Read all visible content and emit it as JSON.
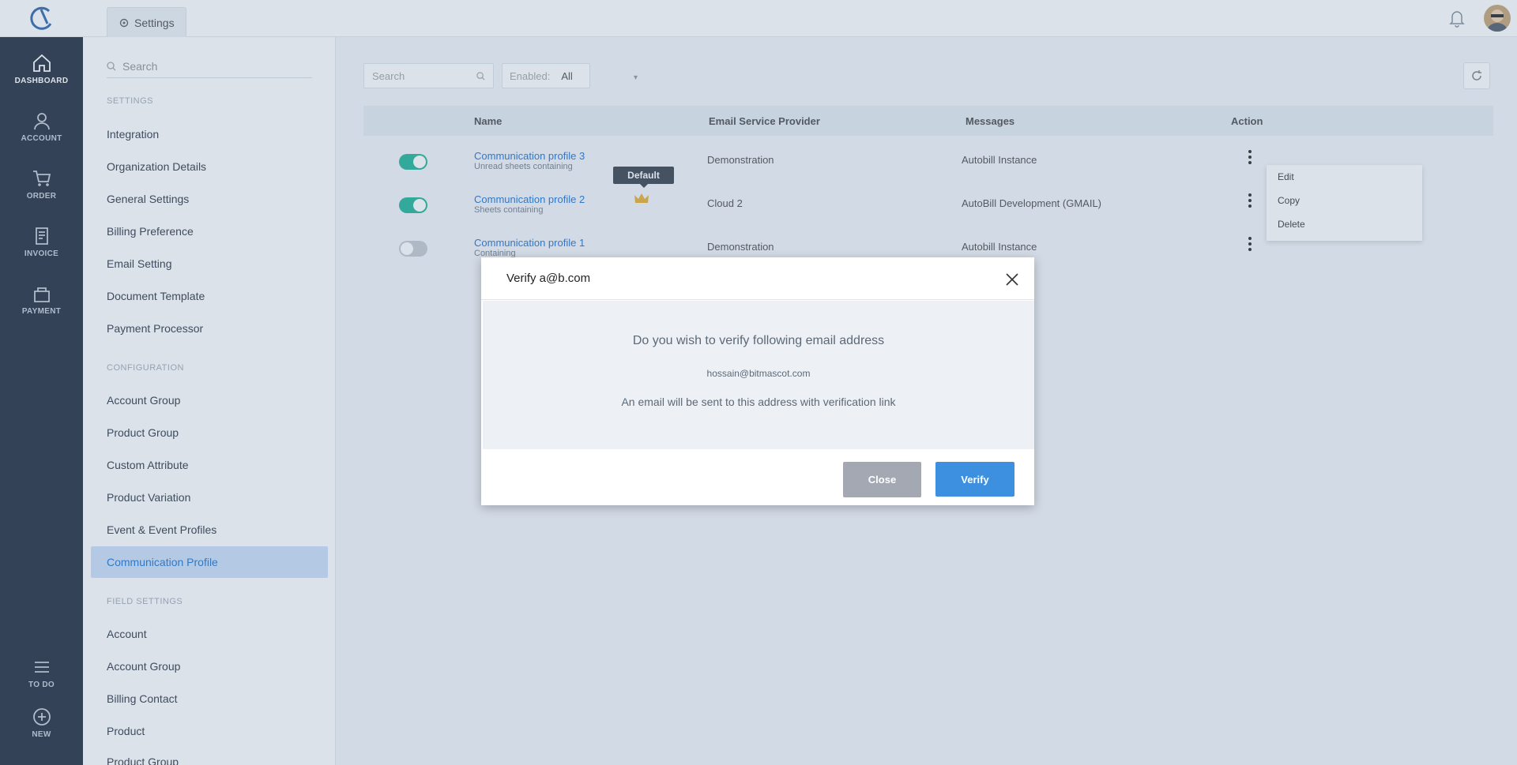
{
  "topbar": {
    "tab_label": "Settings",
    "logo_icon": "logo-icon",
    "bell_icon": "bell-icon"
  },
  "leftnav": {
    "items": [
      {
        "label": "DASHBOARD",
        "icon": "home-icon"
      },
      {
        "label": "ACCOUNT",
        "icon": "user-icon"
      },
      {
        "label": "ORDER",
        "icon": "cart-icon"
      },
      {
        "label": "INVOICE",
        "icon": "invoice-icon"
      },
      {
        "label": "PAYMENT",
        "icon": "payment-icon"
      },
      {
        "label": "TO DO",
        "icon": "list-icon"
      },
      {
        "label": "NEW",
        "icon": "plus-icon"
      }
    ]
  },
  "sidebar": {
    "search_placeholder": "Search",
    "sections": [
      {
        "title": "SETTINGS",
        "items": [
          "Integration",
          "Organization Details",
          "General Settings",
          "Billing Preference",
          "Email Setting",
          "Document Template",
          "Payment Processor"
        ]
      },
      {
        "title": "CONFIGURATION",
        "items": [
          "Account Group",
          "Product Group",
          "Custom Attribute",
          "Product Variation",
          "Event & Event Profiles",
          "Communication Profile"
        ]
      },
      {
        "title": "FIELD SETTINGS",
        "items": [
          "Account",
          "Account Group",
          "Billing Contact",
          "Product",
          "Product Group"
        ]
      }
    ],
    "active_item": "Communication Profile"
  },
  "filters": {
    "search_placeholder": "Search",
    "enabled_label": "Enabled:",
    "enabled_value": "All"
  },
  "table": {
    "headers": {
      "name": "Name",
      "esp": "Email Service Provider",
      "messages": "Messages",
      "action": "Action"
    },
    "rows": [
      {
        "name": "Communication profile 3",
        "sub": "Unread sheets containing",
        "esp": "Demonstration",
        "messages": "Autobill Instance",
        "enabled": true
      },
      {
        "name": "Communication profile 2",
        "sub": "Sheets containing",
        "esp": "Cloud 2",
        "messages": "AutoBill Development (GMAIL)",
        "enabled": true
      },
      {
        "name": "Communication profile 1",
        "sub": "Containing",
        "esp": "Demonstration",
        "messages": "Autobill Instance",
        "enabled": false
      }
    ],
    "default_tag": "Default"
  },
  "context_menu": {
    "items": [
      "Edit",
      "Copy",
      "Delete"
    ]
  },
  "modal": {
    "title": "Verify a@b.com",
    "question": "Do you wish to verify following email address",
    "email": "hossain@bitmascot.com",
    "note": "An email will be sent to this address with verification link",
    "close_label": "Close",
    "verify_label": "Verify"
  },
  "colors": {
    "accent": "#3d8fe0",
    "toggle_on": "#2cb89b",
    "nav_bg": "#2d3748"
  }
}
